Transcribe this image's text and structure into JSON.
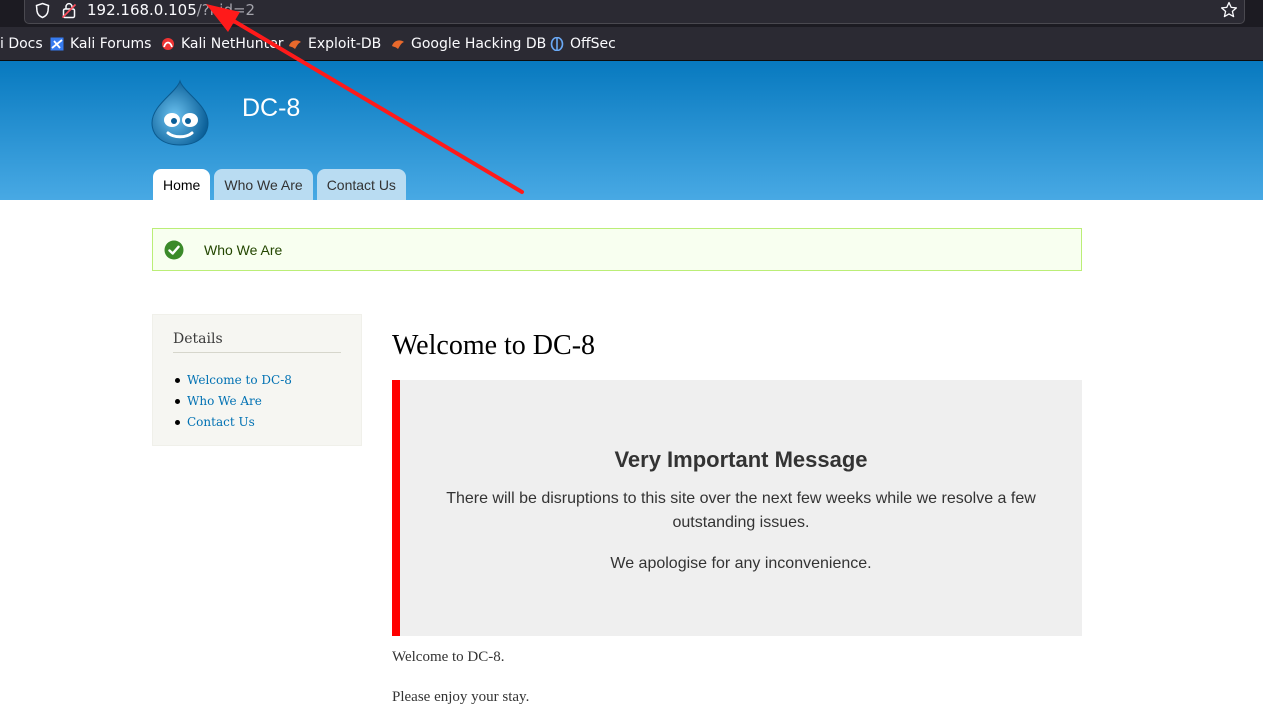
{
  "browser": {
    "url_host": "192.168.0.105",
    "url_path": "/?nid=2",
    "bookmarks": [
      {
        "label": "i Docs"
      },
      {
        "label": "Kali Forums"
      },
      {
        "label": "Kali NetHunter"
      },
      {
        "label": "Exploit-DB"
      },
      {
        "label": "Google Hacking DB"
      },
      {
        "label": "OffSec"
      }
    ]
  },
  "site": {
    "name": "DC-8",
    "tabs": [
      {
        "label": "Home",
        "active": true
      },
      {
        "label": "Who We Are",
        "active": false
      },
      {
        "label": "Contact Us",
        "active": false
      }
    ]
  },
  "status": {
    "message": "Who We Are"
  },
  "sidebar": {
    "title": "Details",
    "links": [
      {
        "label": "Welcome to DC-8"
      },
      {
        "label": "Who We Are"
      },
      {
        "label": "Contact Us"
      }
    ]
  },
  "main": {
    "title": "Welcome to DC-8",
    "notice": {
      "heading": "Very Important Message",
      "line1": "There will be disruptions to this site over the next few weeks while we resolve a few outstanding issues.",
      "line2": "We apologise for any inconvenience."
    },
    "paragraphs": [
      "Welcome to DC-8.",
      "Please enjoy your stay."
    ]
  },
  "colors": {
    "header_top": "#0779bf",
    "header_bottom": "#48a9e4",
    "notice_border": "#ff0000",
    "arrow": "#ff1a1a"
  }
}
